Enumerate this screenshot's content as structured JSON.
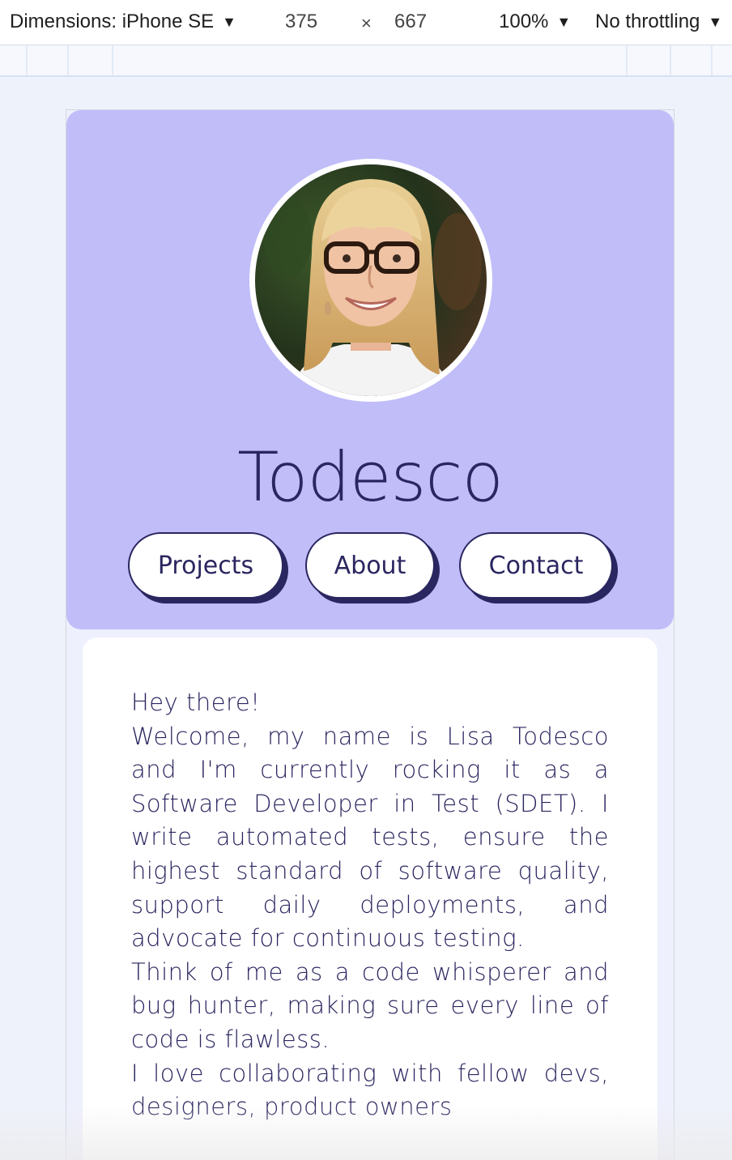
{
  "devtools": {
    "device_label": "Dimensions: iPhone SE",
    "width": "375",
    "times": "×",
    "height": "667",
    "zoom": "100%",
    "throttling": "No throttling"
  },
  "site": {
    "title": "Todesco",
    "avatar_alt": "Portrait of Lisa Todesco",
    "nav": [
      {
        "label": "Projects"
      },
      {
        "label": "About"
      },
      {
        "label": "Contact"
      }
    ],
    "about": {
      "greeting": "Hey there!",
      "paragraph1": "Welcome, my name is Lisa Todesco and I'm currently rocking it as a Software Developer in Test (SDET). I write automated tests, ensure the highest standard of software quality, support daily deployments, and advocate for continuous testing.",
      "paragraph2": "Think of me as a code whisperer and bug hunter, making sure every line of code is flawless.",
      "paragraph3": "I love collaborating with fellow devs, designers, product owners"
    }
  },
  "colors": {
    "hero_bg": "#c0bdf9",
    "ink": "#2a2660",
    "card_bg": "#ffffff",
    "page_bg": "#eef0fd"
  }
}
